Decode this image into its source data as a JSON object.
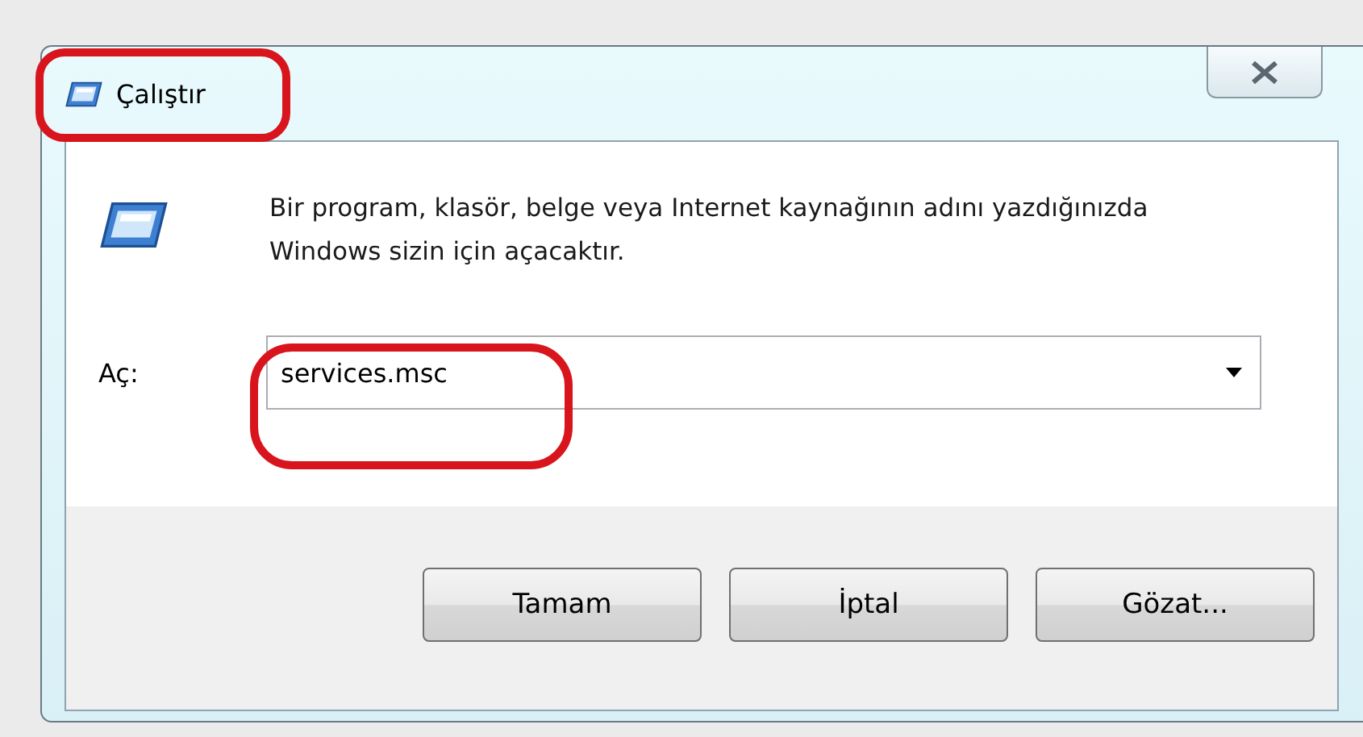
{
  "window": {
    "title": "Çalıştır",
    "highlighted": true
  },
  "description": "Bir program, klasör, belge veya Internet kaynağının adını yazdığınızda Windows sizin için açacaktır.",
  "open_field": {
    "label": "Aç:",
    "value": "services.msc",
    "highlighted": true
  },
  "buttons": [
    "Tamam",
    "İptal",
    "Gözat..."
  ]
}
